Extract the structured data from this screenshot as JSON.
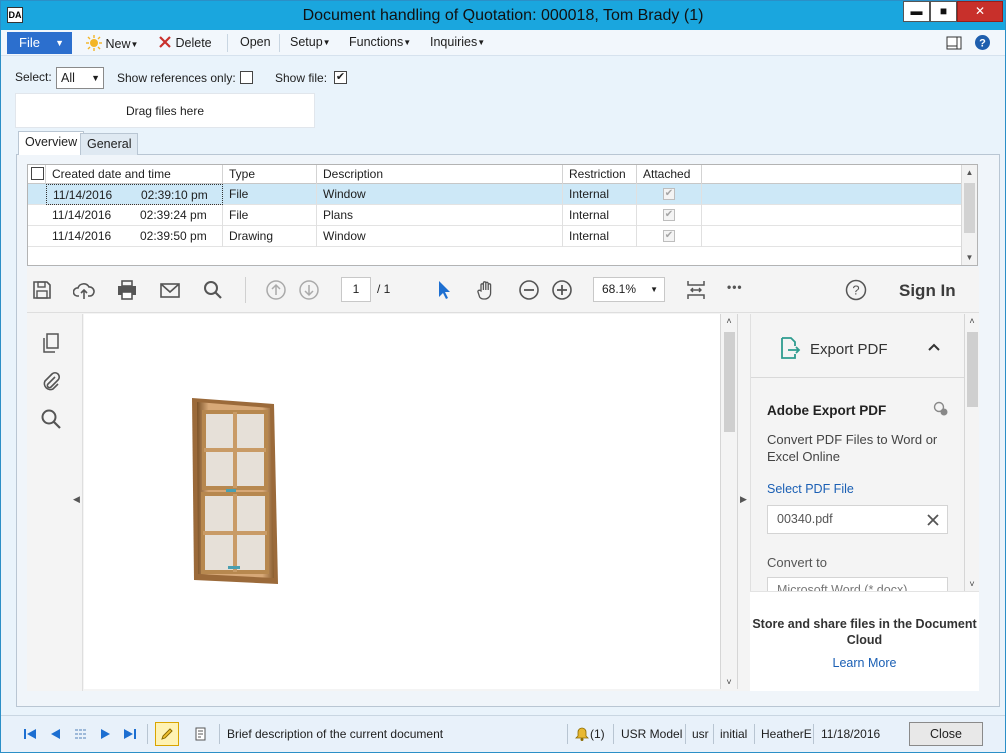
{
  "window": {
    "title": "Document handling of Quotation: 000018, Tom Brady (1)",
    "app_icon_text": "DA",
    "min_glyph": "▬",
    "max_glyph": "■",
    "close_glyph": "✕"
  },
  "menu": {
    "file": "File",
    "new": "New",
    "delete": "Delete",
    "open": "Open",
    "setup": "Setup",
    "functions": "Functions",
    "inquiries": "Inquiries",
    "caret": "▼"
  },
  "filters": {
    "select_label": "Select:",
    "select_value": "All",
    "show_refs_label": "Show references only:",
    "show_refs_checked": false,
    "show_file_label": "Show file:",
    "show_file_checked": true,
    "check_glyph": "✔"
  },
  "dropzone": "Drag files here",
  "tabs": [
    {
      "label": "Overview",
      "active": true
    },
    {
      "label": "General",
      "active": false
    }
  ],
  "grid": {
    "columns": [
      "Created date and time",
      "Type",
      "Description",
      "Restriction",
      "Attached"
    ],
    "rows": [
      {
        "date": "11/14/2016",
        "time": "02:39:10 pm",
        "type": "File",
        "description": "Window",
        "restriction": "Internal",
        "attached": true,
        "selected": true
      },
      {
        "date": "11/14/2016",
        "time": "02:39:24 pm",
        "type": "File",
        "description": "Plans",
        "restriction": "Internal",
        "attached": true,
        "selected": false
      },
      {
        "date": "11/14/2016",
        "time": "02:39:50 pm",
        "type": "Drawing",
        "description": "Window",
        "restriction": "Internal",
        "attached": true,
        "selected": false
      }
    ]
  },
  "pdf": {
    "page_current": "1",
    "page_total": "/ 1",
    "zoom": "68.1%",
    "sign_in": "Sign In",
    "more": "•••",
    "right_pane": {
      "title": "Export PDF",
      "heading": "Adobe Export PDF",
      "description": "Convert PDF Files to Word or Excel Online",
      "select_link": "Select PDF File",
      "file_name": "00340.pdf",
      "convert_to": "Convert to",
      "convert_value": "Microsoft Word (*.docx)",
      "footer_title": "Store and share files in the Document Cloud",
      "footer_link": "Learn More"
    }
  },
  "status": {
    "description": "Brief description of the current document",
    "notifications": "(1)",
    "model": "USR Model",
    "layer": "usr",
    "company": "initial",
    "user": "HeatherE",
    "date": "11/18/2016",
    "close": "Close"
  },
  "colors": {
    "titlebar": "#1aa6de",
    "file_button": "#2c6fce",
    "selected_row": "#cde8f7",
    "link": "#1a5fb4"
  }
}
